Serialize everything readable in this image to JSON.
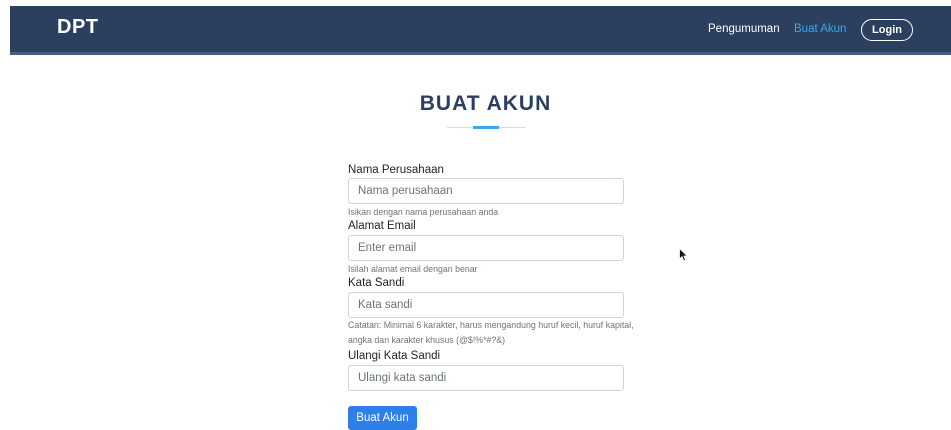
{
  "navbar": {
    "brand": "DPT",
    "links": [
      {
        "label": "Pengumuman"
      },
      {
        "label": "Buat Akun"
      }
    ],
    "login_label": "Login",
    "bg_color": "#2b3f5f",
    "active_color": "#3aa7e8"
  },
  "page": {
    "title": "BUAT AKUN"
  },
  "form": {
    "company": {
      "label": "Nama Perusahaan",
      "placeholder": "Nama perusahaan",
      "help": "Isikan dengan nama perusahaan anda"
    },
    "email": {
      "label": "Alamat Email",
      "placeholder": "Enter email",
      "help": "Isilah alamat email dengan benar"
    },
    "password": {
      "label": "Kata Sandi",
      "placeholder": "Kata sandi",
      "help": "Catatan: Minimal 6 karakter, harus mengandung huruf kecil, huruf kapital, angka dan karakter khusus (@$!%*#?&)"
    },
    "password_confirm": {
      "label": "Ulangi Kata Sandi",
      "placeholder": "Ulangi kata sandi"
    },
    "submit_label": "Buat Akun",
    "button_color": "#2f7fe9"
  }
}
